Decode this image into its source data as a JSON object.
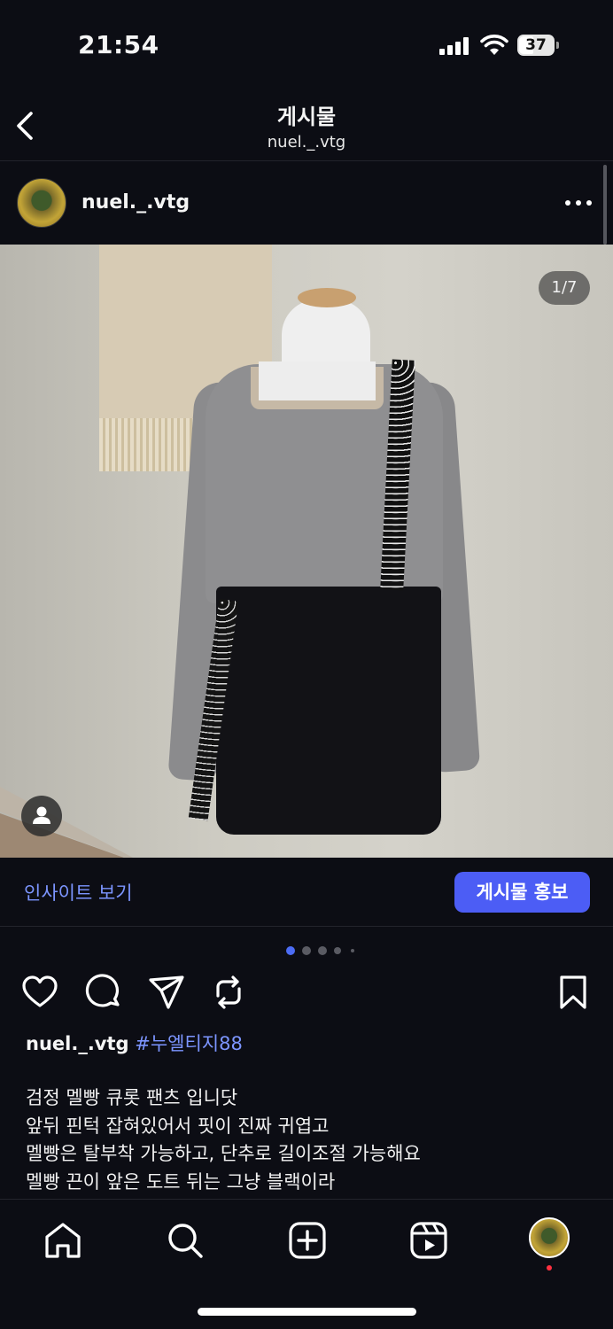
{
  "status_bar": {
    "time": "21:54",
    "battery": "37",
    "icons": [
      "cellular-signal-icon",
      "wifi-icon",
      "battery-icon"
    ]
  },
  "header": {
    "title": "게시물",
    "subtitle": "nuel._.vtg",
    "back_icon": "chevron-left-icon"
  },
  "post": {
    "author": "nuel._.vtg",
    "more_icon": "more-horizontal-icon",
    "page_indicator": "1/7",
    "tag_icon": "person-tag-icon"
  },
  "insights": {
    "link": "인사이트 보기",
    "promote_button": "게시물 홍보"
  },
  "carousel": {
    "current_index": 0,
    "visible_dots": 5
  },
  "actions": {
    "icons": [
      "heart-icon",
      "comment-icon",
      "share-icon",
      "repost-icon",
      "bookmark-icon"
    ]
  },
  "caption": {
    "username": "nuel._.vtg",
    "hashtag": "#누엘티지88",
    "body": "검정 멜빵 큐롯 팬츠 입니닷\n앞뒤 핀턱 잡혀있어서 핏이 진짜 귀엽고\n멜빵은 탈부착 가능하고, 단추로 길이조절 가능해요\n멜빵 끈이 앞은 도트 뒤는 그냥 블랙이라"
  },
  "bottom_nav": {
    "items": [
      "home-icon",
      "search-icon",
      "create-icon",
      "reels-icon",
      "profile-avatar"
    ]
  },
  "colors": {
    "background": "#0c0d14",
    "accent": "#7c95ff",
    "button": "#4c5df5",
    "notification": "#ff3040"
  }
}
